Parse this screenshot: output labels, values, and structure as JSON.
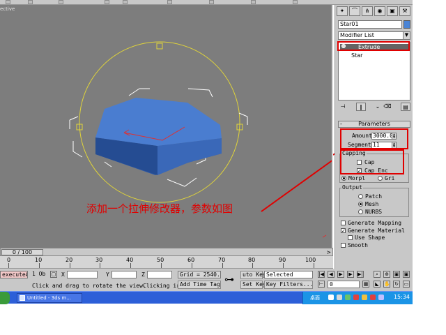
{
  "viewport": {
    "label": "ective",
    "object_color": "#3f6fc6",
    "gizmo_color": "#e0d43a"
  },
  "time_slider": {
    "value": "0 / 100"
  },
  "track_bar": {
    "ticks": [
      "0",
      "10",
      "20",
      "30",
      "40",
      "50",
      "60",
      "70",
      "80",
      "90",
      "100"
    ]
  },
  "status_bar": {
    "maxscript": "executeAc",
    "selection_count": "1 Ob",
    "x_label": "X",
    "y_label": "Y",
    "z_label": "Z",
    "grid": "Grid = 2540.0",
    "auto_key": "uto Key",
    "key_filter_mode": "Selected",
    "set_key": "Set Key",
    "key_filters": "Key Filters...",
    "prompt": "Click and drag to rotate the view.",
    "prompt2": "Clicking ir",
    "add_time_tag": "Add Time Tag",
    "frame": "0"
  },
  "command_panel": {
    "object_name": "Star01",
    "modifier_list_label": "Modifier List",
    "stack": [
      "Extrude",
      "Star"
    ],
    "parameters_title": "Parameters",
    "amount_label": "Amount:",
    "amount_value": "3000.0m",
    "segments_label": "Segments:",
    "segments_value": "11",
    "capping_label": "Capping",
    "cap_start": "Cap",
    "cap_end": "Cap Enc",
    "morph": "Morpl",
    "grid_opt": "Gri",
    "output_label": "Output",
    "output_patch": "Patch",
    "output_mesh": "Mesh",
    "output_nurbs": "NURBS",
    "generate_mapping": "Generate Mapping",
    "generate_material": "Generate Material",
    "use_shape": "Use Shape",
    "smooth": "Smooth"
  },
  "taskbar": {
    "task_label": "Untitled - 3ds m...",
    "tray_text": "桌面",
    "clock": "15:34"
  },
  "annotation": {
    "text": "添加一个拉伸修改器，参数如图",
    "color": "#e00000"
  }
}
